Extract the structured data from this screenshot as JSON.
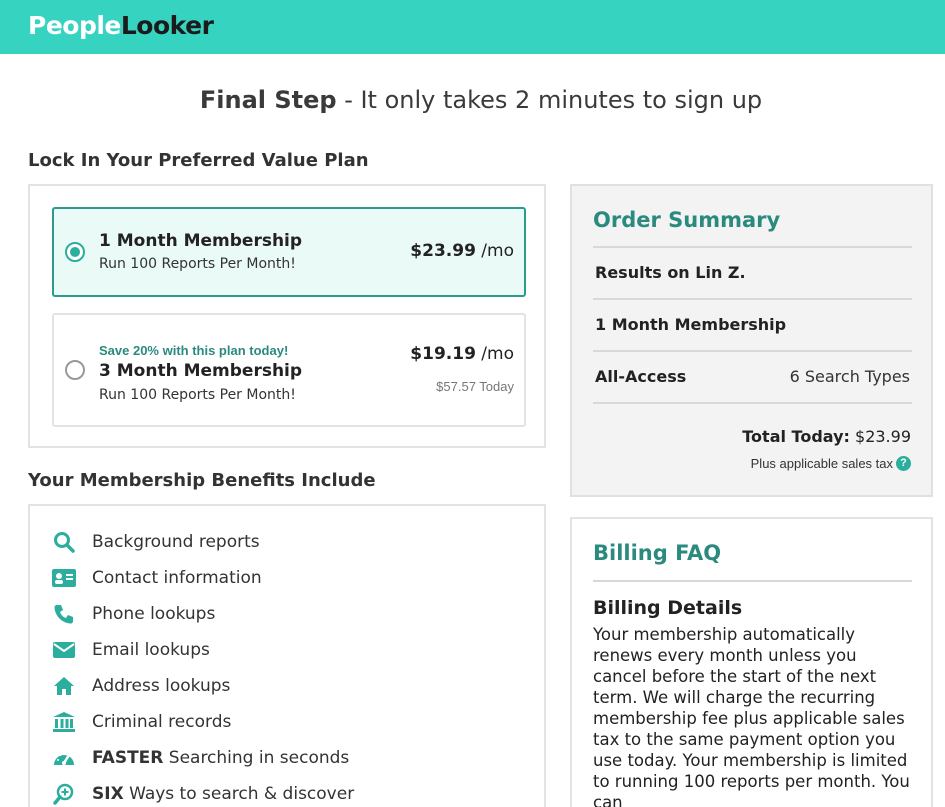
{
  "brand": {
    "part1": "People",
    "part2": "Looker"
  },
  "headline": {
    "bold": "Final Step",
    "rest": " - It only takes 2 minutes to sign up"
  },
  "plans_section": {
    "title": "Lock In Your Preferred Value Plan",
    "plans": [
      {
        "name": "1 Month Membership",
        "sub": "Run 100 Reports Per Month!",
        "price": "$23.99",
        "per": " /mo",
        "selected": true
      },
      {
        "badge": "Save 20% with this plan today!",
        "name": "3 Month Membership",
        "sub": "Run 100 Reports Per Month!",
        "price": "$19.19",
        "per": " /mo",
        "today": "$57.57 Today",
        "selected": false
      }
    ]
  },
  "benefits_section": {
    "title": "Your Membership Benefits Include",
    "items": [
      {
        "icon": "search-icon",
        "text": "Background reports"
      },
      {
        "icon": "id-card-icon",
        "text": "Contact information"
      },
      {
        "icon": "phone-icon",
        "text": "Phone lookups"
      },
      {
        "icon": "envelope-icon",
        "text": "Email lookups"
      },
      {
        "icon": "home-icon",
        "text": "Address lookups"
      },
      {
        "icon": "courthouse-icon",
        "text": "Criminal records"
      },
      {
        "icon": "speedometer-icon",
        "bold": "FASTER",
        "text": " Searching in seconds"
      },
      {
        "icon": "search-plus-icon",
        "bold": "SIX",
        "text": " Ways to search & discover"
      }
    ]
  },
  "order_summary": {
    "title": "Order Summary",
    "results_label": "Results on Lin Z.",
    "plan_label": "1 Month Membership",
    "access_label": "All-Access",
    "access_value": "6 Search Types",
    "total_label": "Total Today:",
    "total_value": " $23.99",
    "tax_note": "Plus applicable sales tax",
    "help_glyph": "?"
  },
  "billing_faq": {
    "title": "Billing FAQ",
    "subtitle": "Billing Details",
    "body": "Your membership automatically renews every month unless you cancel before the start of the next term. We will charge the recurring membership fee plus applicable sales tax to the same payment option you use today. Your membership is limited to running 100 reports per month. You can"
  },
  "colors": {
    "brand_teal": "#35d3c0",
    "accent": "#2a8a7e",
    "icon": "#2bae9d"
  }
}
